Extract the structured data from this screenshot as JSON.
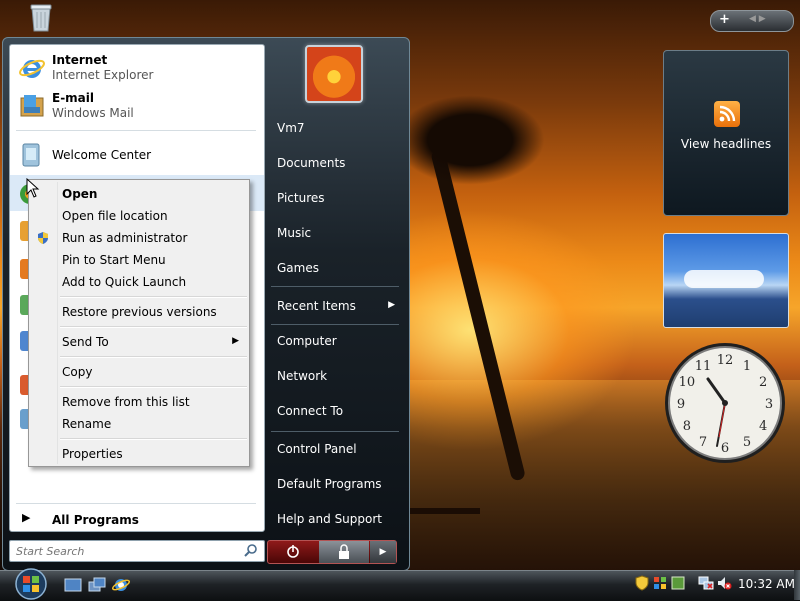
{
  "start_menu": {
    "pinned": [
      {
        "title": "Internet",
        "subtitle": "Internet Explorer",
        "icon": "internet-explorer-icon"
      },
      {
        "title": "E-mail",
        "subtitle": "Windows Mail",
        "icon": "windows-mail-icon"
      }
    ],
    "recent": [
      {
        "title": "Welcome Center",
        "icon": "welcome-center-icon"
      }
    ],
    "all_programs": "All Programs",
    "search_placeholder": "Start Search",
    "user_name": "Vm7",
    "right_items": [
      "Documents",
      "Pictures",
      "Music",
      "Games",
      "Recent Items",
      "Computer",
      "Network",
      "Connect To",
      "Control Panel",
      "Default Programs",
      "Help and Support"
    ]
  },
  "context_menu": {
    "items": [
      "Open",
      "Open file location",
      "Run as administrator",
      "Pin to Start Menu",
      "Add to Quick Launch",
      "Restore previous versions",
      "Send To",
      "Copy",
      "Remove from this list",
      "Rename",
      "Properties"
    ]
  },
  "gadgets": {
    "feed_label": "View headlines",
    "clock_numbers": [
      "12",
      "1",
      "2",
      "3",
      "4",
      "5",
      "6",
      "7",
      "8",
      "9",
      "10",
      "11"
    ]
  },
  "taskbar": {
    "time": "10:32 AM"
  },
  "colors": {
    "menu_hover": "#dbe9f7",
    "power_red": "#8f1a1a",
    "feed_orange": "#f08c1b"
  }
}
